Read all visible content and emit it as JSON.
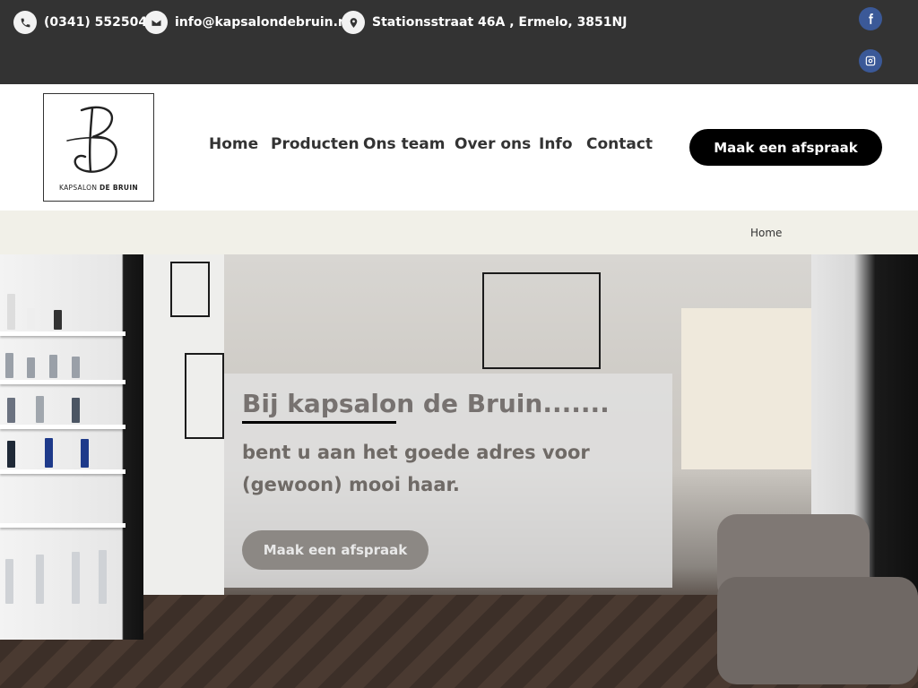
{
  "topbar": {
    "phone": "(0341) 552504",
    "email": "info@kapsalondebruin.nl",
    "address": "Stationsstraat 46A , Ermelo, 3851NJ",
    "icons": {
      "phone": "phone-icon",
      "email": "envelope-icon",
      "address": "map-pin-icon",
      "facebook": "facebook-icon",
      "instagram": "instagram-icon"
    },
    "social_color": "#3b5998",
    "background": "#333333"
  },
  "header": {
    "logo": {
      "text_light": "KAPSALON ",
      "text_bold": "DE BRUIN"
    },
    "nav": [
      "Home",
      "Producten",
      "Ons team",
      "Over ons",
      "Info",
      "Contact"
    ],
    "cta": "Maak een afspraak"
  },
  "breadcrumb": {
    "current": "Home",
    "background": "#f1f0e8"
  },
  "hero": {
    "title": "Bij kapsalon de Bruin.......",
    "subtitle": "bent u aan het goede adres voor (gewoon) mooi haar.",
    "cta": "Maak een afspraak"
  }
}
